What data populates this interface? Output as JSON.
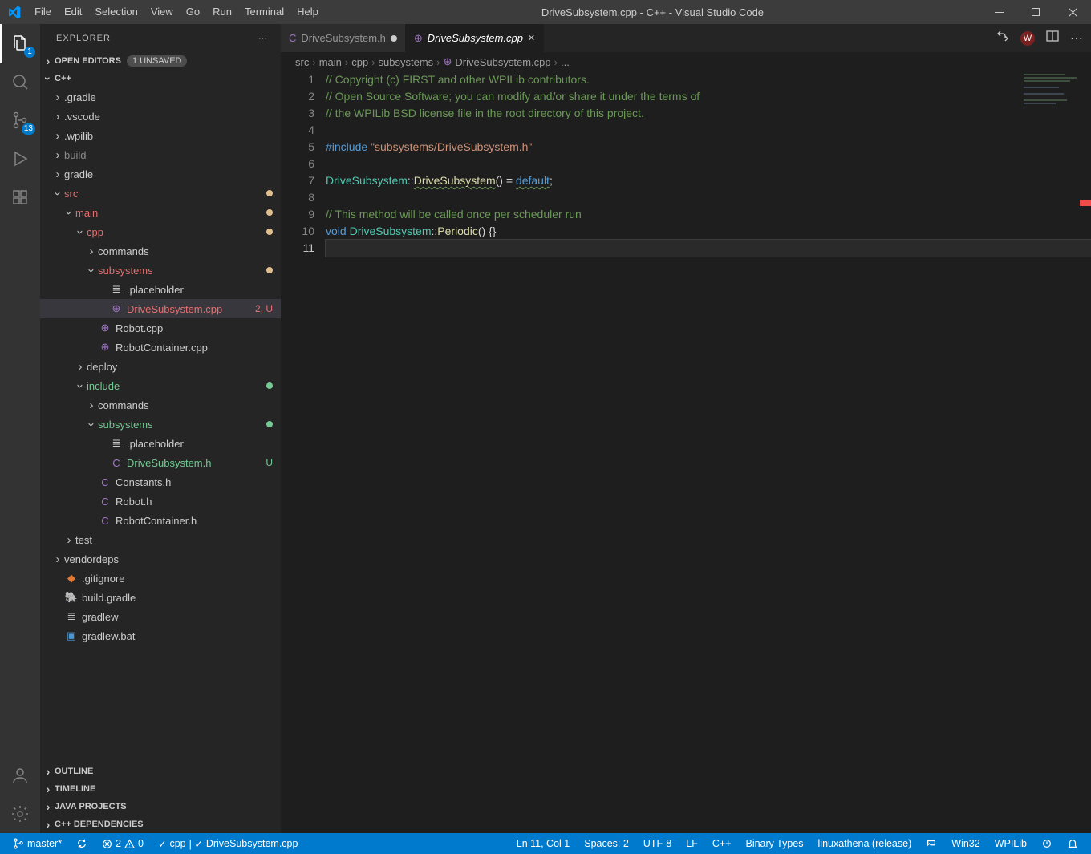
{
  "titlebar": {
    "menus": [
      "File",
      "Edit",
      "Selection",
      "View",
      "Go",
      "Run",
      "Terminal",
      "Help"
    ],
    "title": "DriveSubsystem.cpp - C++ - Visual Studio Code"
  },
  "activity": {
    "explorer_badge": "1",
    "scm_badge": "13"
  },
  "sidebar": {
    "header": "EXPLORER",
    "open_editors": {
      "label": "OPEN EDITORS",
      "unsaved": "1 UNSAVED"
    },
    "root": "C++",
    "tree": {
      "gradle_folder": ".gradle",
      "vscode_folder": ".vscode",
      "wpilib_folder": ".wpilib",
      "build_folder": "build",
      "gradle2": "gradle",
      "src": "src",
      "main": "main",
      "cpp": "cpp",
      "commands1": "commands",
      "subsystems1": "subsystems",
      "placeholder1": ".placeholder",
      "drive_cpp": "DriveSubsystem.cpp",
      "drive_cpp_stat": "2, U",
      "robot_cpp": "Robot.cpp",
      "rc_cpp": "RobotContainer.cpp",
      "deploy": "deploy",
      "include": "include",
      "commands2": "commands",
      "subsystems2": "subsystems",
      "placeholder2": ".placeholder",
      "drive_h": "DriveSubsystem.h",
      "drive_h_stat": "U",
      "constants_h": "Constants.h",
      "robot_h": "Robot.h",
      "rc_h": "RobotContainer.h",
      "test": "test",
      "vendordeps": "vendordeps",
      "gitignore": ".gitignore",
      "build_gradle": "build.gradle",
      "gradlew": "gradlew",
      "gradlew_bat": "gradlew.bat"
    },
    "sections": {
      "outline": "OUTLINE",
      "timeline": "TIMELINE",
      "java_projects": "JAVA PROJECTS",
      "cpp_deps": "C++ DEPENDENCIES"
    }
  },
  "tabs": {
    "t1": "DriveSubsystem.h",
    "t2": "DriveSubsystem.cpp"
  },
  "breadcrumb": {
    "p1": "src",
    "p2": "main",
    "p3": "cpp",
    "p4": "subsystems",
    "p5": "DriveSubsystem.cpp",
    "p6": "..."
  },
  "code": {
    "line_numbers": [
      "1",
      "2",
      "3",
      "4",
      "5",
      "6",
      "7",
      "8",
      "9",
      "10",
      "11"
    ],
    "l1": "// Copyright (c) FIRST and other WPILib contributors.",
    "l2": "// Open Source Software; you can modify and/or share it under the terms of",
    "l3": "// the WPILib BSD license file in the root directory of this project.",
    "l5_include": "#include",
    "l5_str": " \"subsystems/DriveSubsystem.h\"",
    "l7_t": "DriveSubsystem",
    "l7_sep": "::",
    "l7_f": "DriveSubsystem",
    "l7_p": "() = ",
    "l7_kw": "default",
    "l7_semi": ";",
    "l9": "// This method will be called once per scheduler run",
    "l10_void": "void",
    "l10_sp": " ",
    "l10_t": "DriveSubsystem",
    "l10_sep": "::",
    "l10_f": "Periodic",
    "l10_tail": "() {}"
  },
  "status": {
    "branch": "master*",
    "errors": "2",
    "warnings": "0",
    "lang_sel": "cpp",
    "active_file": "DriveSubsystem.cpp",
    "pos": "Ln 11, Col 1",
    "spaces": "Spaces: 2",
    "enc": "UTF-8",
    "eol": "LF",
    "lang": "C++",
    "smart": "Binary Types",
    "target": "linuxathena (release)",
    "win32": "Win32",
    "wpilib": "WPILib"
  }
}
